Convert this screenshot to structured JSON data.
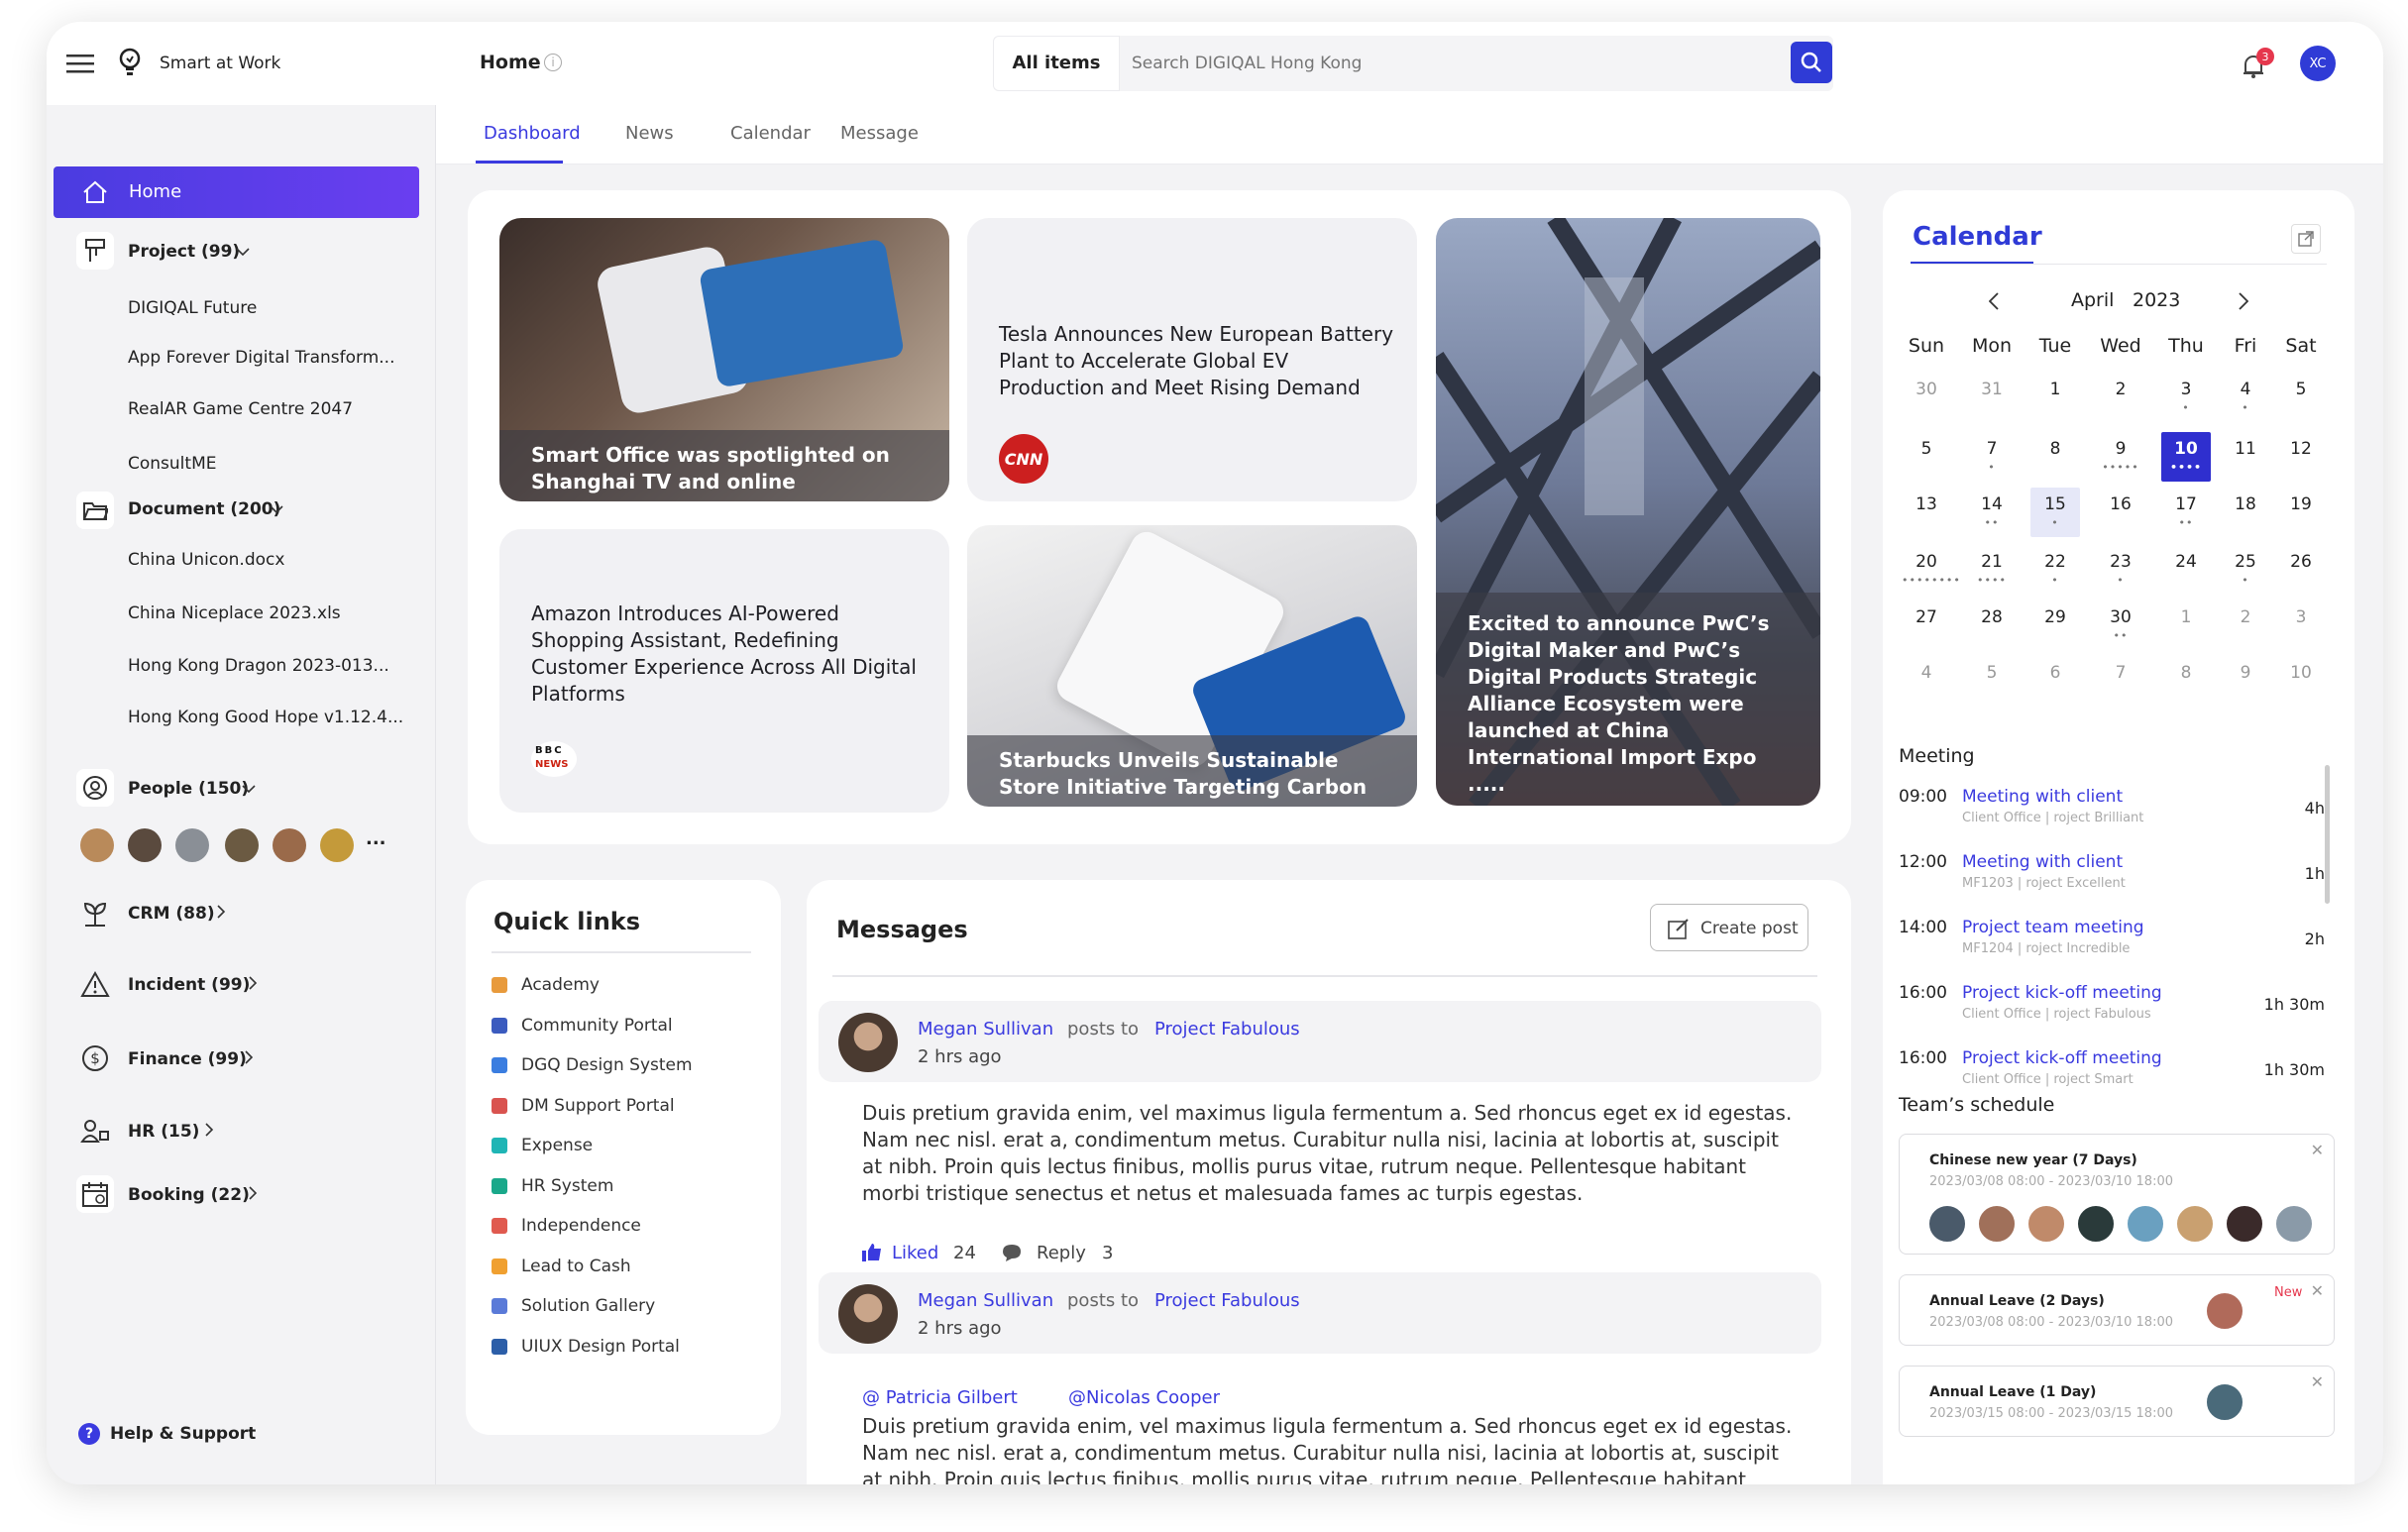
{
  "app": {
    "name": "Smart at Work",
    "page": "Home",
    "user_initials": "XC",
    "notif_count": "3"
  },
  "search": {
    "scope": "All items",
    "placeholder": "Search DIGIQAL Hong Kong"
  },
  "tabs": [
    "Dashboard",
    "News",
    "Calendar",
    "Message"
  ],
  "sidebar": {
    "home": "Home",
    "project": {
      "label": "Project (99)",
      "items": [
        "DIGIQAL Future",
        "App Forever Digital Transform...",
        "RealAR Game Centre 2047",
        "ConsultME"
      ]
    },
    "document": {
      "label": "Document (200)",
      "items": [
        "China Unicon.docx",
        "China Niceplace 2023.xls",
        "Hong Kong Dragon 2023-013...",
        "Hong Kong Good Hope v1.12.4..."
      ]
    },
    "people": {
      "label": "People (150)",
      "more": "..."
    },
    "crm": "CRM (88)",
    "incident": "Incident (99)",
    "finance": "Finance (99)",
    "hr": "HR (15)",
    "booking": "Booking (22)",
    "help": "Help & Support"
  },
  "news": [
    {
      "text": "Smart Office was spotlighted on Shanghai TV and online"
    },
    {
      "text": "Tesla Announces New European Battery Plant to Accelerate Global EV Production and Meet Rising Demand",
      "source": "CNN"
    },
    {
      "text": "Excited to announce PwC’s Digital Maker and PwC’s Digital Products Strategic Alliance Ecosystem were launched at China International Import Expo ....."
    },
    {
      "text": "Amazon Introduces AI-Powered Shopping Assistant, Redefining Customer Experience Across All Digital Platforms",
      "source_top": "BBC",
      "source_bottom": "NEWS"
    },
    {
      "text": "Starbucks Unveils Sustainable Store Initiative Targeting Carbon ..."
    }
  ],
  "quick_links": {
    "title": "Quick links",
    "items": [
      {
        "label": "Academy",
        "color": "#e89a3c"
      },
      {
        "label": "Community Portal",
        "color": "#3b5bbf"
      },
      {
        "label": "DGQ Design System",
        "color": "#3a7de0"
      },
      {
        "label": "DM Support Portal",
        "color": "#d9534f"
      },
      {
        "label": "Expense",
        "color": "#1fb5b5"
      },
      {
        "label": "HR System",
        "color": "#1aa88a"
      },
      {
        "label": "Independence",
        "color": "#e05a4f"
      },
      {
        "label": "Lead to Cash",
        "color": "#f0a030"
      },
      {
        "label": "Solution Gallery",
        "color": "#5a7ad8"
      },
      {
        "label": "UIUX Design Portal",
        "color": "#2c5ea8"
      }
    ]
  },
  "messages": {
    "title": "Messages",
    "create": "Create post",
    "posts": [
      {
        "author": "Megan Sullivan",
        "posts_to": "posts to",
        "project": "Project Fabulous",
        "time": "2 hrs ago",
        "body": "Duis pretium gravida enim, vel maximus ligula fermentum a. Sed rhoncus eget ex id egestas. Nam nec nisl. erat a, condimentum metus. Curabitur nulla nisi, lacinia at lobortis at, suscipit at nibh. Proin quis lectus finibus, mollis purus vitae, rutrum neque. Pellentesque habitant morbi tristique senectus et netus et malesuada fames ac turpis egestas.",
        "liked": "Liked",
        "likes": "24",
        "reply": "Reply",
        "replies": "3"
      },
      {
        "author": "Megan Sullivan",
        "posts_to": "posts to",
        "project": "Project Fabulous",
        "time": "2 hrs ago",
        "mention1": "@ Patricia Gilbert",
        "mention2": "@Nicolas Cooper",
        "body": "Duis pretium gravida enim, vel maximus ligula fermentum a. Sed rhoncus eget ex id egestas. Nam nec nisl. erat a, condimentum metus. Curabitur nulla nisi, lacinia at lobortis at, suscipit at nibh. Proin quis lectus finibus, mollis purus vitae, rutrum neque. Pellentesque habitant morbi tristique senectus et"
      }
    ]
  },
  "calendar": {
    "title": "Calendar",
    "month": "April",
    "year": "2023",
    "weekdays": [
      "Sun",
      "Mon",
      "Tue",
      "Wed",
      "Thu",
      "Fri",
      "Sat"
    ],
    "weeks": [
      [
        "30",
        "31",
        "1",
        "2",
        "3",
        "4",
        "5"
      ],
      [
        "5",
        "7",
        "8",
        "9",
        "10",
        "11",
        "12"
      ],
      [
        "13",
        "14",
        "15",
        "16",
        "17",
        "18",
        "19"
      ],
      [
        "20",
        "21",
        "22",
        "23",
        "24",
        "25",
        "26"
      ],
      [
        "27",
        "28",
        "29",
        "30",
        "1",
        "2",
        "3"
      ],
      [
        "4",
        "5",
        "6",
        "7",
        "8",
        "9",
        "10"
      ]
    ],
    "dots": [
      [
        "",
        "",
        "",
        "",
        "•",
        "•",
        ""
      ],
      [
        "",
        "•",
        "",
        "•••••",
        "••••",
        "",
        ""
      ],
      [
        "",
        "••",
        "•",
        "",
        "••",
        "",
        ""
      ],
      [
        "••••••••",
        "••••",
        "•",
        "•",
        "",
        "•",
        ""
      ],
      [
        "",
        "",
        "",
        "••",
        "",
        "",
        ""
      ],
      [
        "",
        "",
        "",
        "",
        "",
        "",
        ""
      ]
    ],
    "meeting_title": "Meeting",
    "meetings": [
      {
        "time": "09:00",
        "name": "Meeting with client",
        "sub": "Client Office | roject Brilliant",
        "dur": "4h"
      },
      {
        "time": "12:00",
        "name": "Meeting with client",
        "sub": "MF1203 | roject Excellent",
        "dur": "1h"
      },
      {
        "time": "14:00",
        "name": "Project team meeting",
        "sub": "MF1204 | roject Incredible",
        "dur": "2h"
      },
      {
        "time": "16:00",
        "name": "Project kick-off meeting",
        "sub": "Client Office | roject Fabulous",
        "dur": "1h 30m"
      },
      {
        "time": "16:00",
        "name": "Project kick-off meeting",
        "sub": "Client Office | roject Smart",
        "dur": "1h 30m"
      }
    ],
    "team_title": "Team’s schedule",
    "team": [
      {
        "title": "Chinese new year (7 Days)",
        "range": "2023/03/08 08:00 - 2023/03/10 18:00"
      },
      {
        "title": "Annual Leave (2 Days)",
        "range": "2023/03/08 08:00 - 2023/03/10 18:00",
        "badge": "New"
      },
      {
        "title": "Annual Leave (1 Day)",
        "range": "2023/03/15 08:00 - 2023/03/15 18:00"
      }
    ]
  }
}
